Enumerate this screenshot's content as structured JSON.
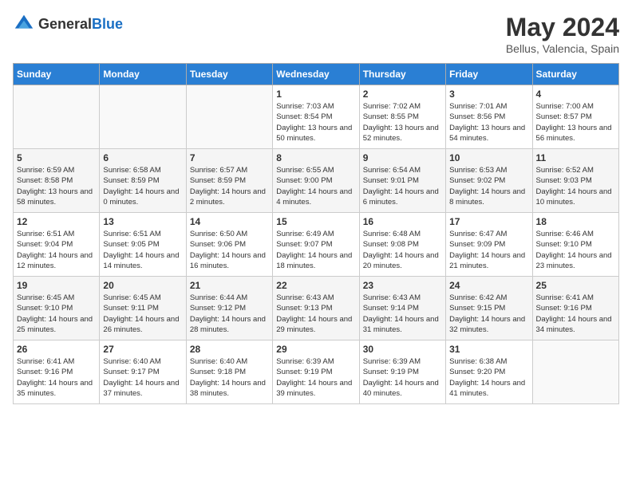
{
  "header": {
    "logo_general": "General",
    "logo_blue": "Blue",
    "month_title": "May 2024",
    "location": "Bellus, Valencia, Spain"
  },
  "weekdays": [
    "Sunday",
    "Monday",
    "Tuesday",
    "Wednesday",
    "Thursday",
    "Friday",
    "Saturday"
  ],
  "weeks": [
    [
      {
        "day": "",
        "sunrise": "",
        "sunset": "",
        "daylight": ""
      },
      {
        "day": "",
        "sunrise": "",
        "sunset": "",
        "daylight": ""
      },
      {
        "day": "",
        "sunrise": "",
        "sunset": "",
        "daylight": ""
      },
      {
        "day": "1",
        "sunrise": "Sunrise: 7:03 AM",
        "sunset": "Sunset: 8:54 PM",
        "daylight": "Daylight: 13 hours and 50 minutes."
      },
      {
        "day": "2",
        "sunrise": "Sunrise: 7:02 AM",
        "sunset": "Sunset: 8:55 PM",
        "daylight": "Daylight: 13 hours and 52 minutes."
      },
      {
        "day": "3",
        "sunrise": "Sunrise: 7:01 AM",
        "sunset": "Sunset: 8:56 PM",
        "daylight": "Daylight: 13 hours and 54 minutes."
      },
      {
        "day": "4",
        "sunrise": "Sunrise: 7:00 AM",
        "sunset": "Sunset: 8:57 PM",
        "daylight": "Daylight: 13 hours and 56 minutes."
      }
    ],
    [
      {
        "day": "5",
        "sunrise": "Sunrise: 6:59 AM",
        "sunset": "Sunset: 8:58 PM",
        "daylight": "Daylight: 13 hours and 58 minutes."
      },
      {
        "day": "6",
        "sunrise": "Sunrise: 6:58 AM",
        "sunset": "Sunset: 8:59 PM",
        "daylight": "Daylight: 14 hours and 0 minutes."
      },
      {
        "day": "7",
        "sunrise": "Sunrise: 6:57 AM",
        "sunset": "Sunset: 8:59 PM",
        "daylight": "Daylight: 14 hours and 2 minutes."
      },
      {
        "day": "8",
        "sunrise": "Sunrise: 6:55 AM",
        "sunset": "Sunset: 9:00 PM",
        "daylight": "Daylight: 14 hours and 4 minutes."
      },
      {
        "day": "9",
        "sunrise": "Sunrise: 6:54 AM",
        "sunset": "Sunset: 9:01 PM",
        "daylight": "Daylight: 14 hours and 6 minutes."
      },
      {
        "day": "10",
        "sunrise": "Sunrise: 6:53 AM",
        "sunset": "Sunset: 9:02 PM",
        "daylight": "Daylight: 14 hours and 8 minutes."
      },
      {
        "day": "11",
        "sunrise": "Sunrise: 6:52 AM",
        "sunset": "Sunset: 9:03 PM",
        "daylight": "Daylight: 14 hours and 10 minutes."
      }
    ],
    [
      {
        "day": "12",
        "sunrise": "Sunrise: 6:51 AM",
        "sunset": "Sunset: 9:04 PM",
        "daylight": "Daylight: 14 hours and 12 minutes."
      },
      {
        "day": "13",
        "sunrise": "Sunrise: 6:51 AM",
        "sunset": "Sunset: 9:05 PM",
        "daylight": "Daylight: 14 hours and 14 minutes."
      },
      {
        "day": "14",
        "sunrise": "Sunrise: 6:50 AM",
        "sunset": "Sunset: 9:06 PM",
        "daylight": "Daylight: 14 hours and 16 minutes."
      },
      {
        "day": "15",
        "sunrise": "Sunrise: 6:49 AM",
        "sunset": "Sunset: 9:07 PM",
        "daylight": "Daylight: 14 hours and 18 minutes."
      },
      {
        "day": "16",
        "sunrise": "Sunrise: 6:48 AM",
        "sunset": "Sunset: 9:08 PM",
        "daylight": "Daylight: 14 hours and 20 minutes."
      },
      {
        "day": "17",
        "sunrise": "Sunrise: 6:47 AM",
        "sunset": "Sunset: 9:09 PM",
        "daylight": "Daylight: 14 hours and 21 minutes."
      },
      {
        "day": "18",
        "sunrise": "Sunrise: 6:46 AM",
        "sunset": "Sunset: 9:10 PM",
        "daylight": "Daylight: 14 hours and 23 minutes."
      }
    ],
    [
      {
        "day": "19",
        "sunrise": "Sunrise: 6:45 AM",
        "sunset": "Sunset: 9:10 PM",
        "daylight": "Daylight: 14 hours and 25 minutes."
      },
      {
        "day": "20",
        "sunrise": "Sunrise: 6:45 AM",
        "sunset": "Sunset: 9:11 PM",
        "daylight": "Daylight: 14 hours and 26 minutes."
      },
      {
        "day": "21",
        "sunrise": "Sunrise: 6:44 AM",
        "sunset": "Sunset: 9:12 PM",
        "daylight": "Daylight: 14 hours and 28 minutes."
      },
      {
        "day": "22",
        "sunrise": "Sunrise: 6:43 AM",
        "sunset": "Sunset: 9:13 PM",
        "daylight": "Daylight: 14 hours and 29 minutes."
      },
      {
        "day": "23",
        "sunrise": "Sunrise: 6:43 AM",
        "sunset": "Sunset: 9:14 PM",
        "daylight": "Daylight: 14 hours and 31 minutes."
      },
      {
        "day": "24",
        "sunrise": "Sunrise: 6:42 AM",
        "sunset": "Sunset: 9:15 PM",
        "daylight": "Daylight: 14 hours and 32 minutes."
      },
      {
        "day": "25",
        "sunrise": "Sunrise: 6:41 AM",
        "sunset": "Sunset: 9:16 PM",
        "daylight": "Daylight: 14 hours and 34 minutes."
      }
    ],
    [
      {
        "day": "26",
        "sunrise": "Sunrise: 6:41 AM",
        "sunset": "Sunset: 9:16 PM",
        "daylight": "Daylight: 14 hours and 35 minutes."
      },
      {
        "day": "27",
        "sunrise": "Sunrise: 6:40 AM",
        "sunset": "Sunset: 9:17 PM",
        "daylight": "Daylight: 14 hours and 37 minutes."
      },
      {
        "day": "28",
        "sunrise": "Sunrise: 6:40 AM",
        "sunset": "Sunset: 9:18 PM",
        "daylight": "Daylight: 14 hours and 38 minutes."
      },
      {
        "day": "29",
        "sunrise": "Sunrise: 6:39 AM",
        "sunset": "Sunset: 9:19 PM",
        "daylight": "Daylight: 14 hours and 39 minutes."
      },
      {
        "day": "30",
        "sunrise": "Sunrise: 6:39 AM",
        "sunset": "Sunset: 9:19 PM",
        "daylight": "Daylight: 14 hours and 40 minutes."
      },
      {
        "day": "31",
        "sunrise": "Sunrise: 6:38 AM",
        "sunset": "Sunset: 9:20 PM",
        "daylight": "Daylight: 14 hours and 41 minutes."
      },
      {
        "day": "",
        "sunrise": "",
        "sunset": "",
        "daylight": ""
      }
    ]
  ]
}
